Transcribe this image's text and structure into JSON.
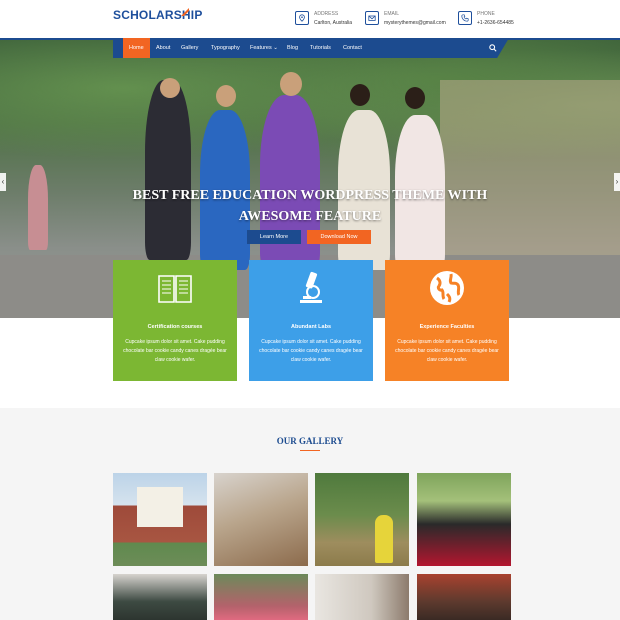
{
  "header": {
    "logo": "SCHOLARSHIP",
    "contacts": [
      {
        "label": "ADDRESS",
        "value": "Carlton, Australia",
        "icon": "map-pin-icon"
      },
      {
        "label": "EMAIL",
        "value": "mysterythemes@gmail.com",
        "icon": "envelope-icon"
      },
      {
        "label": "PHONE",
        "value": "+1-2636-654485",
        "icon": "phone-icon"
      }
    ]
  },
  "nav": {
    "items": [
      "Home",
      "About",
      "Gallery",
      "Typography",
      "Features ⌄",
      "Blog",
      "Tutorials",
      "Contact"
    ],
    "search_icon": "search-icon"
  },
  "hero": {
    "title": "BEST FREE EDUCATION WORDPRESS THEME WITH AWESOME FEATURE",
    "learn_more": "Learn More",
    "download_now": "Download Now",
    "prev_arrow": "‹",
    "next_arrow": "›"
  },
  "features": [
    {
      "title": "Certification courses",
      "desc": "Cupcake ipsum dolor sit amet. Cake pudding chocolate bar cookie candy canes dragée bear claw cookie wafer.",
      "color": "#7cb733",
      "icon": "book-icon"
    },
    {
      "title": "Abundant Labs",
      "desc": "Cupcake ipsum dolor sit amet. Cake pudding chocolate bar cookie candy canes dragée bear claw cookie wafer.",
      "color": "#3d9fe8",
      "icon": "microscope-icon"
    },
    {
      "title": "Experience Faculties",
      "desc": "Cupcake ipsum dolor sit amet. Cake pudding chocolate bar cookie candy canes dragée bear claw cookie wafer.",
      "color": "#f68226",
      "icon": "globe-icon"
    }
  ],
  "gallery": {
    "title": "OUR GALLERY"
  },
  "colors": {
    "brand_blue": "#1c4b8f",
    "accent_orange": "#f26522"
  }
}
